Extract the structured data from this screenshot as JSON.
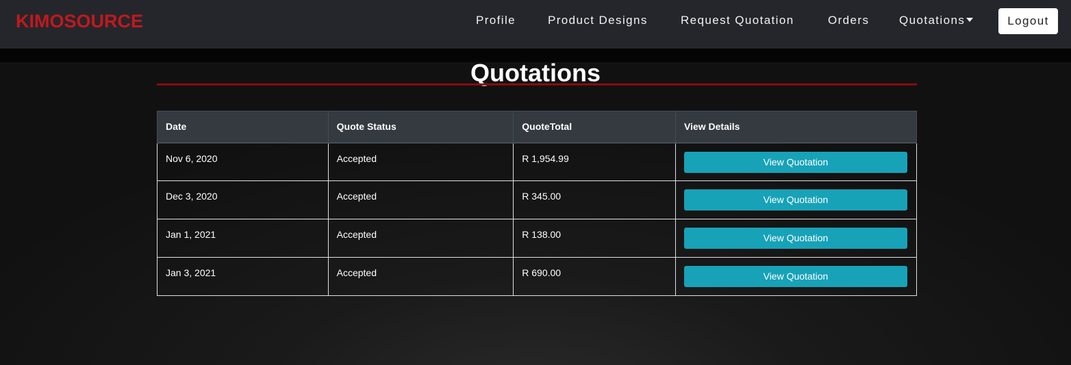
{
  "brand": "KIMOSOURCE",
  "nav": {
    "profile": "Profile",
    "product_designs": "Product Designs",
    "request_quotation": "Request Quotation",
    "orders": "Orders",
    "quotations": "Quotations",
    "logout": "Logout"
  },
  "page": {
    "title": "Quotations"
  },
  "table": {
    "headers": [
      "Date",
      "Quote Status",
      "QuoteTotal",
      "View Details"
    ],
    "rows": [
      {
        "date": "Nov 6, 2020",
        "status": "Accepted",
        "total": "R 1,954.99",
        "action": "View Quotation"
      },
      {
        "date": "Dec 3, 2020",
        "status": "Accepted",
        "total": "R 345.00",
        "action": "View Quotation"
      },
      {
        "date": "Jan 1, 2021",
        "status": "Accepted",
        "total": "R 138.00",
        "action": "View Quotation"
      },
      {
        "date": "Jan 3, 2021",
        "status": "Accepted",
        "total": "R 690.00",
        "action": "View Quotation"
      }
    ]
  },
  "colors": {
    "brand": "#c0191e",
    "navbar": "#25262b",
    "accent_button": "#17a2b8",
    "title_rule": "#8b0b0b"
  },
  "icons": {
    "quotations_dropdown": "caret-down-icon"
  }
}
